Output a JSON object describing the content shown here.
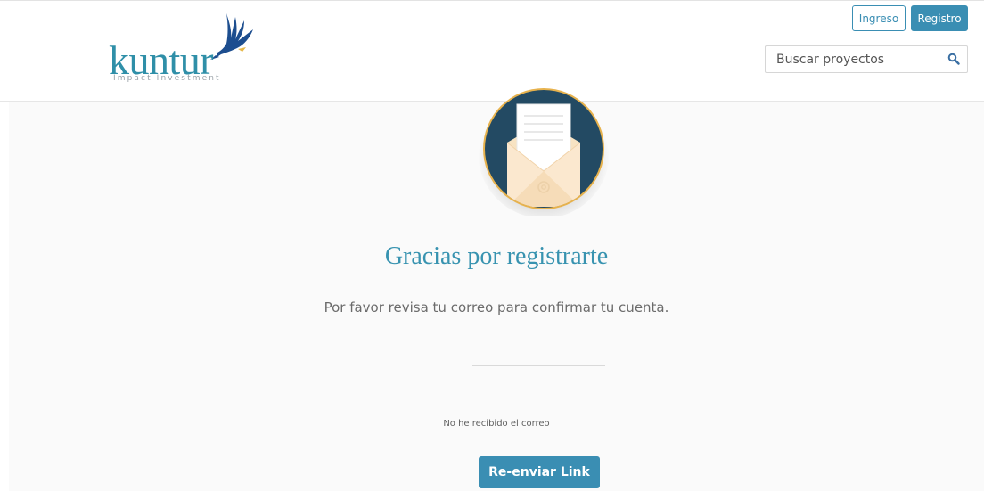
{
  "header": {
    "logo": {
      "word": "kuntur",
      "tagline": "Impact Investment"
    },
    "login_label": "Ingreso",
    "register_label": "Registro",
    "search": {
      "placeholder": "Buscar proyectos",
      "icon": "search-icon"
    }
  },
  "confirmation": {
    "icon": "envelope-icon",
    "title": "Gracias por registrarte",
    "message": "Por favor revisa tu correo para confirmar tu cuenta.",
    "not_received_text": "No he recibido el correo",
    "resend_label": "Re-enviar Link"
  },
  "colors": {
    "brand": "#2f8fa8",
    "button": "#3a8eb3",
    "badge_navy": "#234a63",
    "badge_ring": "#e7b24d"
  }
}
